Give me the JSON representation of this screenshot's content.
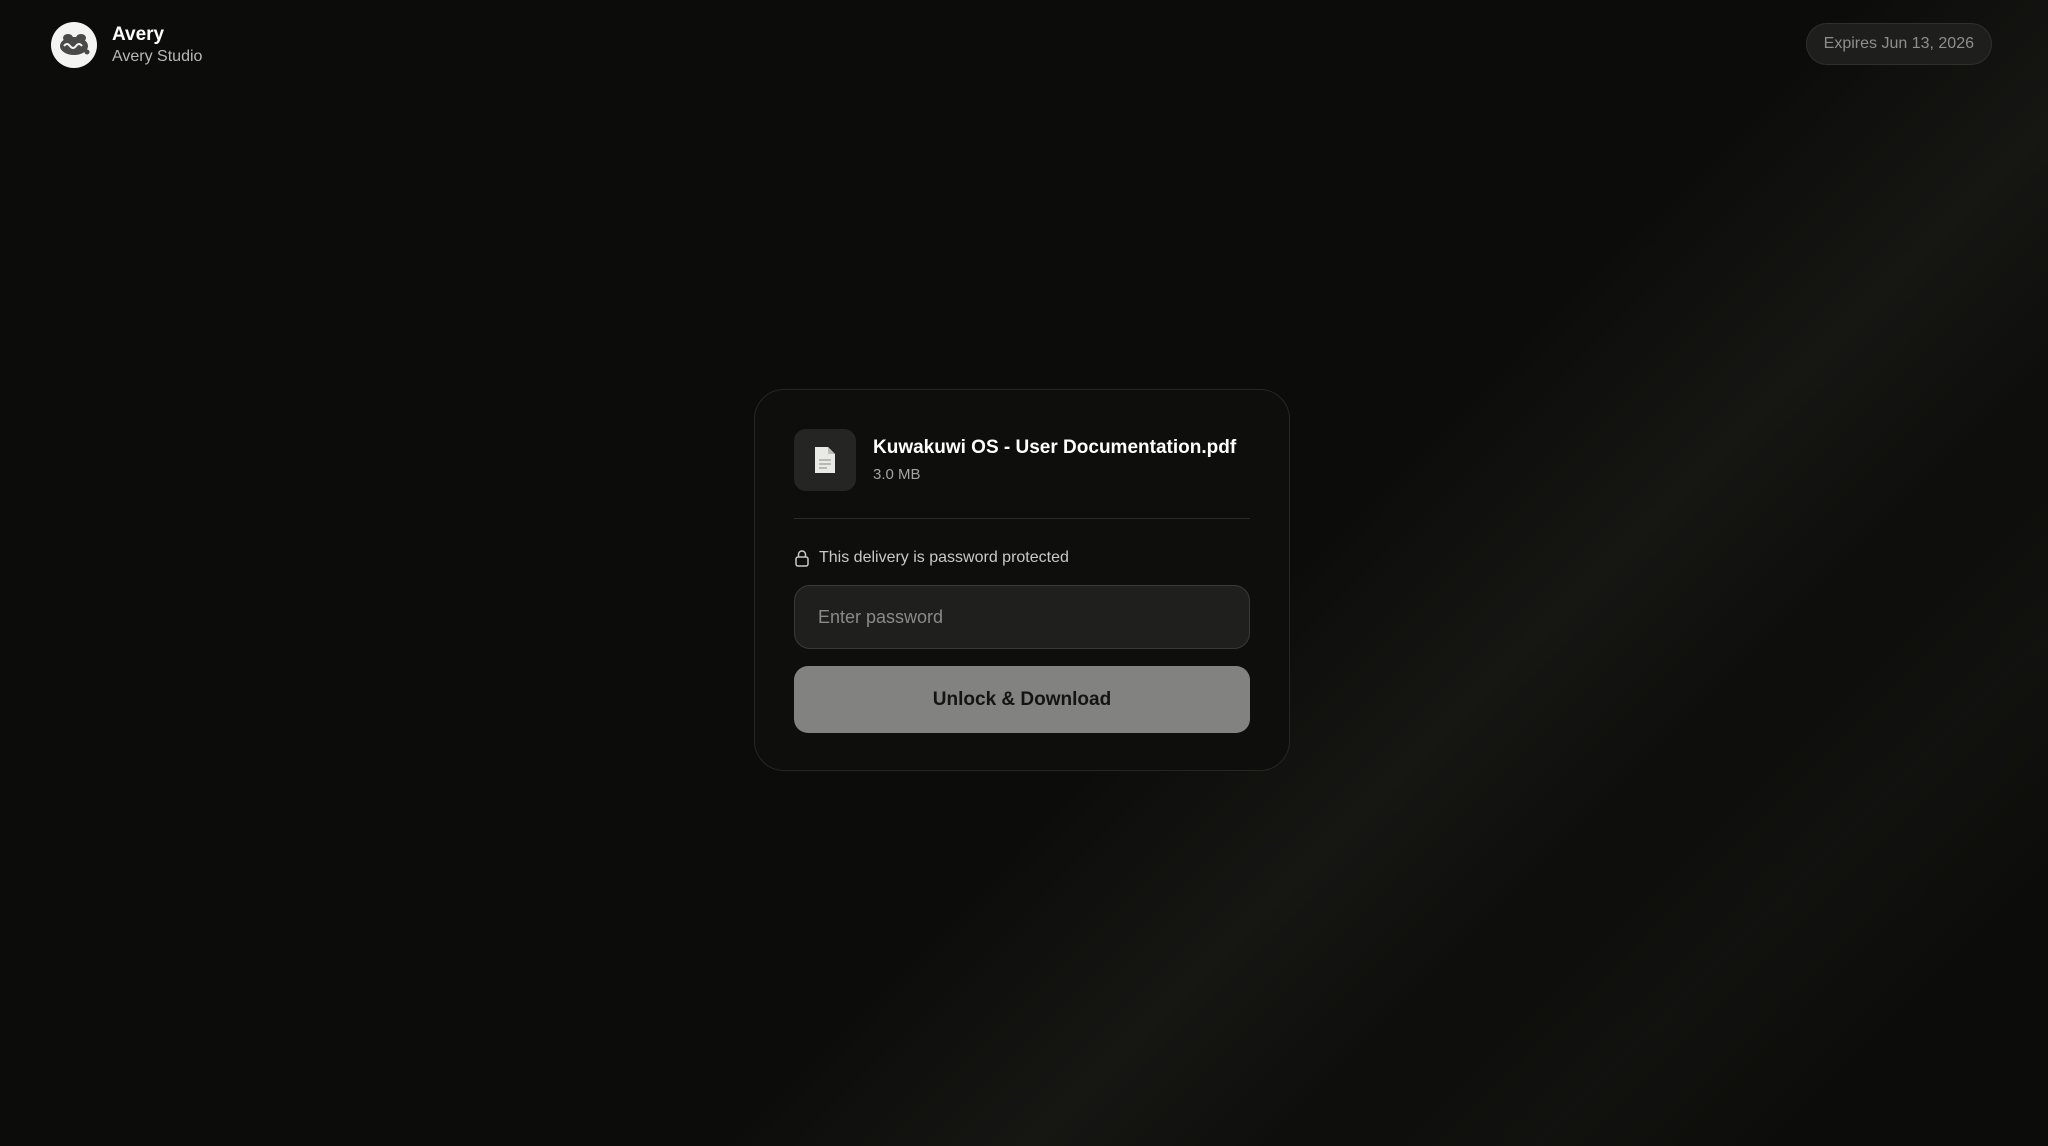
{
  "header": {
    "brand_name": "Avery",
    "brand_subtitle": "Avery Studio",
    "avatar_icon": "avery-logo-icon",
    "expires_label": "Expires Jun 13, 2026"
  },
  "card": {
    "file": {
      "icon": "document-icon",
      "name": "Kuwakuwi OS - User Documentation.pdf",
      "size": "3.0 MB"
    },
    "protection": {
      "icon": "lock-icon",
      "text": "This delivery is password protected"
    },
    "password_input": {
      "placeholder": "Enter password",
      "value": ""
    },
    "unlock_button_label": "Unlock & Download"
  },
  "colors": {
    "background": "#0c0c0a",
    "card_background": "#0e0e0c",
    "button_background": "#828280",
    "input_background": "#1f1f1d",
    "expires_pill_background": "#1e1e1c"
  }
}
